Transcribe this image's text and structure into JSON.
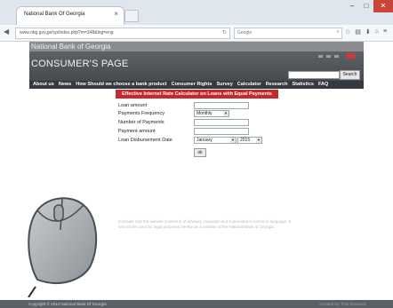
{
  "browser": {
    "tab_title": "National Bank Of Georgia",
    "tab_close": "×",
    "url": "www.nbg.gov.ge/cp/index.php?m=348&lng=eng",
    "search_engine": "Google",
    "win_min": "–",
    "win_max": "□",
    "win_close": "✕"
  },
  "site": {
    "brand": "National Bank of Georgia",
    "banner_title": "CONSUMER'S PAGE",
    "search_button": "Search",
    "menu": [
      "About us",
      "News",
      "How Should we choose a bank product",
      "Consumer Rights",
      "Survey",
      "Calculator",
      "Research",
      "Statistics",
      "FAQ"
    ]
  },
  "calculator": {
    "title": "Effective Internet Rate Calculator on Loans with Equal Payments",
    "loan_amount_label": "Loan amount",
    "frequency_label": "Payments Frequency",
    "frequency_value": "Monthly",
    "num_payments_label": "Number of Payments",
    "payment_amount_label": "Payment amount",
    "disbursement_label": "Loan Disbursement Date",
    "month_value": "January",
    "year_value": "2015",
    "ok_label": "ok"
  },
  "disclaimer": "Consider that the website content is of advisory character and is provided in common language. It can not be used for legal purposes hereby as a position of the National Bank of Georgia.",
  "footer": {
    "copyright": "Copyright © 2014 National Bank Of Georgia",
    "credit": "Created by: Fine Business"
  },
  "colors": {
    "accent_red": "#c8272b",
    "menu_bg": "#343a40",
    "banner_bg": "#474b50"
  },
  "icons": [
    "back-icon",
    "reload-icon",
    "search-icon",
    "star-icon",
    "home-icon",
    "menu-icon",
    "mouse-icon",
    "flag-icon"
  ]
}
